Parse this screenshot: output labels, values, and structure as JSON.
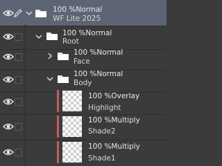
{
  "layers": [
    {
      "opacity_blend": "100 %Normal",
      "name": "WF Lite 2025",
      "type": "folder",
      "expanded": true,
      "selected": true
    },
    {
      "opacity_blend": "100 %Normal",
      "name": "Root",
      "type": "folder",
      "expanded": true
    },
    {
      "opacity_blend": "100 %Normal",
      "name": "Face",
      "type": "folder",
      "expanded": false
    },
    {
      "opacity_blend": "100 %Normal",
      "name": "Body",
      "type": "folder",
      "expanded": true
    },
    {
      "opacity_blend": "100 %Overlay",
      "name": "Highlight",
      "type": "raster",
      "color_label": "#c85a5a"
    },
    {
      "opacity_blend": "100 %Multiply",
      "name": "Shade2",
      "type": "raster",
      "color_label": "#c85a5a"
    },
    {
      "opacity_blend": "100 %Multiply",
      "name": "Shade1",
      "type": "raster",
      "color_label": "#c85a5a"
    }
  ],
  "icons": {
    "visibility": "eye-icon",
    "edit": "pencil-icon",
    "lock": "lock-checkbox",
    "expand": "chevron-icon",
    "folder": "folder-icon"
  }
}
